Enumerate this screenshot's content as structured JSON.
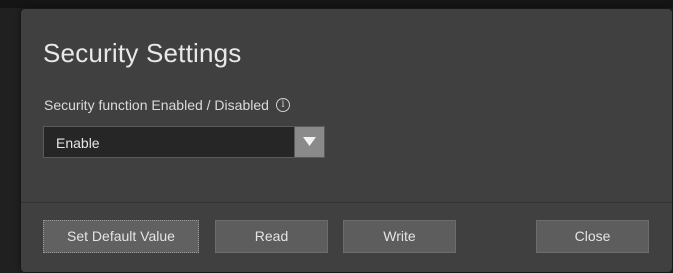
{
  "dialog": {
    "title": "Security Settings"
  },
  "security_field": {
    "label": "Security function Enabled / Disabled",
    "info_icon": "info-icon",
    "info_glyph": "i",
    "selected_value": "Enable"
  },
  "buttons": {
    "set_default": "Set Default Value",
    "read": "Read",
    "write": "Write",
    "close": "Close"
  },
  "colors": {
    "dialog_bg": "#404040",
    "button_bg": "#5d5d5d",
    "select_bg": "#262626",
    "select_arrow_bg": "#8a8a8a"
  }
}
